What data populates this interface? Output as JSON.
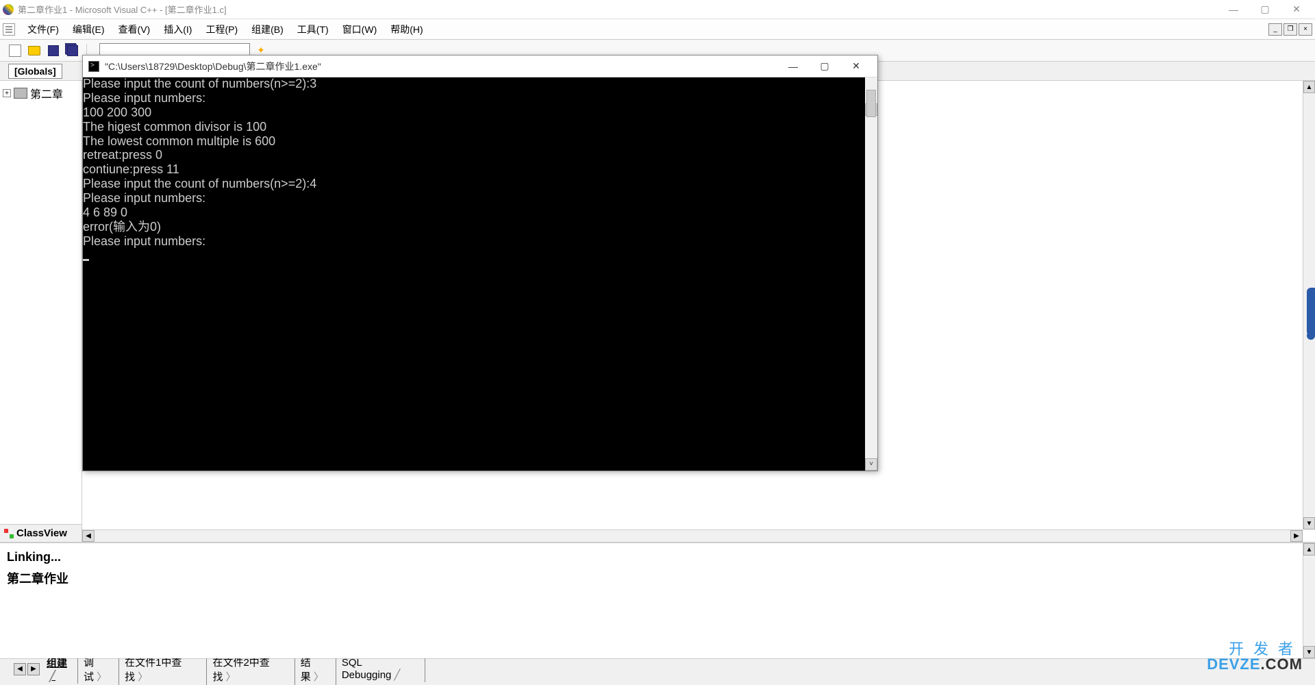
{
  "window": {
    "title": "第二章作业1 - Microsoft Visual C++ - [第二章作业1.c]"
  },
  "menu": {
    "file": "文件(F)",
    "edit": "编辑(E)",
    "view": "查看(V)",
    "insert": "插入(I)",
    "project": "工程(P)",
    "build": "组建(B)",
    "tools": "工具(T)",
    "window": "窗口(W)",
    "help": "帮助(H)"
  },
  "globals": {
    "label": "[Globals]"
  },
  "sidebar": {
    "tree_item": "第二章",
    "classview": "ClassView"
  },
  "output": {
    "line1": "Linking...",
    "line2": "第二章作业"
  },
  "bottom_tabs": {
    "build": "组建",
    "debug": "调试",
    "find1": "在文件1中查找",
    "find2": "在文件2中查找",
    "result": "结果",
    "sql": "SQL Debugging"
  },
  "console": {
    "title": "\"C:\\Users\\18729\\Desktop\\Debug\\第二章作业1.exe\"",
    "lines": [
      "Please input the count of numbers(n>=2):3",
      "Please input numbers:",
      "100 200 300",
      "The higest common divisor is 100",
      "The lowest common multiple is 600",
      "retreat:press 0",
      "contiune:press 11",
      "Please input the count of numbers(n>=2):4",
      "Please input numbers:",
      "4 6 89 0",
      "error(输入为0)",
      "Please input numbers:"
    ]
  },
  "watermark": {
    "cn": "开发者",
    "en1": "DEVZE",
    "en2": ".COM"
  }
}
